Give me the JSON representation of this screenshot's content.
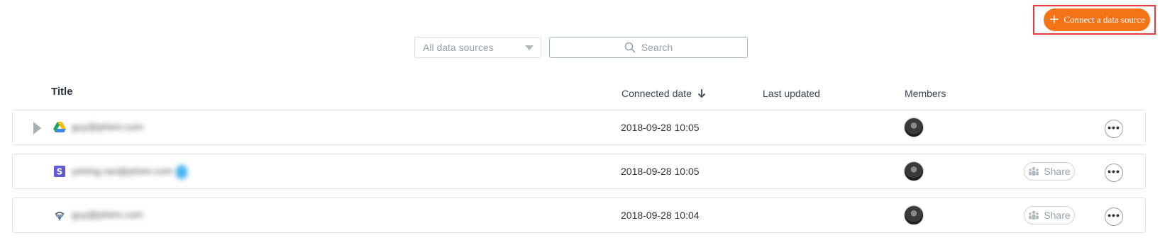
{
  "header": {
    "connect_button_label": "Connect a data source",
    "connect_button_icon": "plus-icon",
    "accent_color": "#f57317",
    "highlight_color": "#e53935"
  },
  "filters": {
    "source_select_value": "All data sources",
    "search_placeholder": "Search"
  },
  "table": {
    "columns": {
      "title": "Title",
      "connected_date": "Connected date",
      "last_updated": "Last updated",
      "members": "Members"
    },
    "sort_icon": "arrow-down-icon",
    "rows": [
      {
        "source_icon": "google-drive-icon",
        "title": "guy@phimi.com",
        "connected_date": "2018-09-28 10:05",
        "last_updated": "",
        "share_label": "",
        "more_label": "•••"
      },
      {
        "source_icon": "stripe-icon",
        "title": "yiming.ran@phimi.com",
        "connected_date": "2018-09-28 10:05",
        "last_updated": "",
        "share_label": "Share",
        "more_label": "•••"
      },
      {
        "source_icon": "data-source-icon",
        "title": "guy@phimi.com",
        "connected_date": "2018-09-28 10:04",
        "last_updated": "",
        "share_label": "Share",
        "more_label": "•••"
      }
    ]
  }
}
